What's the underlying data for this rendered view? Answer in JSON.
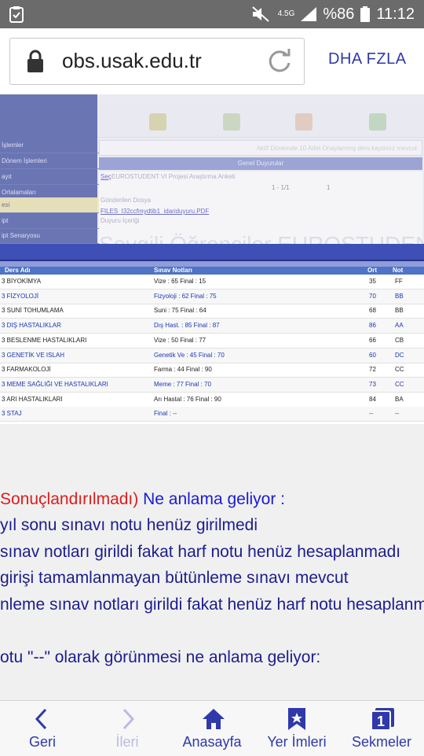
{
  "status_bar": {
    "network": "4.5G",
    "battery": "%86",
    "time": "11:12"
  },
  "browser": {
    "url": "obs.usak.edu.tr",
    "menu_label": "DHA FZLA"
  },
  "background_page": {
    "sidebar": [
      "İşlemler",
      "Dönem İşlemleri",
      "ayıt",
      "Ortalamaları",
      "esi",
      "ipt",
      "ipt Senaryosu"
    ],
    "notice": "Aktif Dönemde 10 Adet Onaylanmış ders kaydınız mevcut",
    "panel_title": "Genel Duyurular",
    "announce_link": "Seç",
    "announce_text": "EUROSTUDENT VI Projesi Araştırma Anketi",
    "pager": "1 - 1/1",
    "pager_page": "1",
    "sender_label": "Gönderilen Dosya",
    "file_name": "FILES_I32ccfmydtib1_idariduyuru.PDF",
    "content_label": "Duyuru İçeriği",
    "big_title": "Sevgili Öğrenciler EUROSTUDENT"
  },
  "grades": {
    "headers": {
      "course": "Ders Adı",
      "exam": "Sınav Notları",
      "avg": "Ort",
      "grade": "Not"
    },
    "rows": [
      {
        "course": "3 BİYOKİMYA",
        "exam": "Vize : 65   Final : 15",
        "avg": "35",
        "grade": "FF",
        "blue": false
      },
      {
        "course": "3 FİZYOLOJİ",
        "exam": "Fizyoloji : 62   Final : 75",
        "avg": "70",
        "grade": "BB",
        "blue": true
      },
      {
        "course": "3 SUNİ TOHUMLAMA",
        "exam": "Suni : 75   Final : 64",
        "avg": "68",
        "grade": "BB",
        "blue": false
      },
      {
        "course": "3 DIŞ HASTALIKLAR",
        "exam": "Dış Hast. : 85   Final : 87",
        "avg": "86",
        "grade": "AA",
        "blue": true
      },
      {
        "course": "3 BESLENME HASTALIKLARI",
        "exam": "Vize : 50   Final : 77",
        "avg": "66",
        "grade": "CB",
        "blue": false
      },
      {
        "course": "3 GENETİK VE ISLAH",
        "exam": "Genetik Ve : 45   Final : 70",
        "avg": "60",
        "grade": "DC",
        "blue": true
      },
      {
        "course": "3 FARMAKOLOJİ",
        "exam": "Farma : 44   Final : 90",
        "avg": "72",
        "grade": "CC",
        "blue": false
      },
      {
        "course": "3 MEME SAĞLIĞI VE HASTALIKLARI",
        "exam": "Meme : 77   Final : 70",
        "avg": "73",
        "grade": "CC",
        "blue": true
      },
      {
        "course": "3 ARI HASTALIKLARI",
        "exam": "Arı Hastal : 76   Final : 90",
        "avg": "84",
        "grade": "BA",
        "blue": false
      },
      {
        "course": "3 STAJ",
        "exam": "Final : --",
        "avg": "--",
        "grade": "--",
        "blue": true
      }
    ]
  },
  "explanation": {
    "line1_red": "Sonuçlandırılmadı)",
    "line1_blue": " Ne anlama geliyor :",
    "line2": "yıl sonu sınavı notu henüz girilmedi",
    "line3": " sınav notları girildi fakat harf notu henüz hesaplanmadı",
    "line4": "girişi tamamlanmayan bütünleme sınavı mevcut",
    "line5": "nleme sınav notları girildi fakat henüz harf notu hesaplanmadı",
    "line6": "otu \"--\" olarak görünmesi ne anlama geliyor:"
  },
  "bottom_nav": [
    {
      "label": "Geri",
      "icon": "back-icon"
    },
    {
      "label": "İleri",
      "icon": "forward-icon"
    },
    {
      "label": "Anasayfa",
      "icon": "home-icon"
    },
    {
      "label": "Yer İmleri",
      "icon": "bookmark-icon"
    },
    {
      "label": "Sekmeler",
      "icon": "tabs-icon",
      "count": "1"
    }
  ]
}
